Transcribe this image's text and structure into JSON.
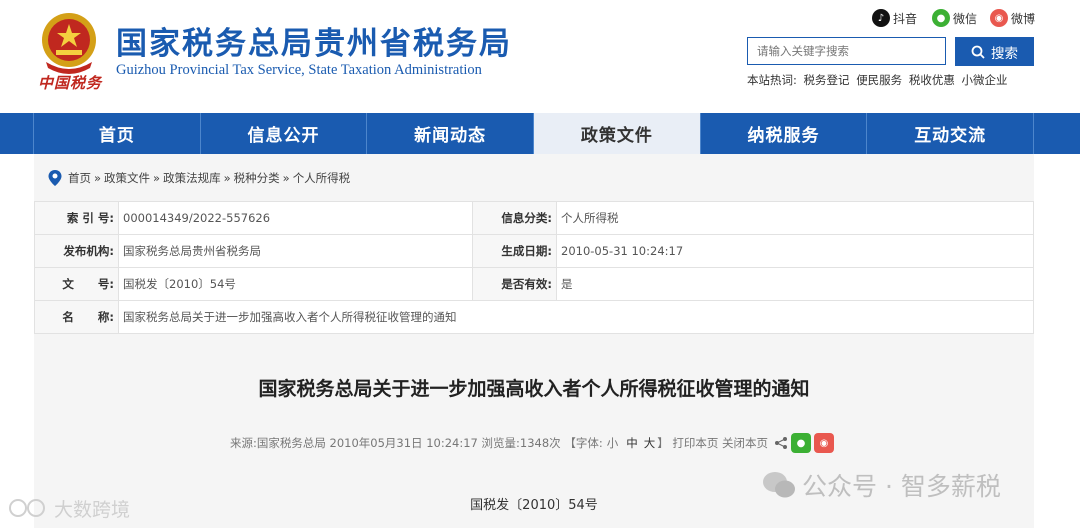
{
  "header": {
    "title": "国家税务总局贵州省税务局",
    "subtitle": "Guizhou Provincial Tax Service, State Taxation Administration",
    "logo_text": "中国税务",
    "social": [
      {
        "label": "抖音",
        "icon": "douyin-icon",
        "color": "#111111"
      },
      {
        "label": "微信",
        "icon": "wechat-icon",
        "color": "#3cb034"
      },
      {
        "label": "微博",
        "icon": "weibo-icon",
        "color": "#e9584f"
      }
    ],
    "search": {
      "placeholder": "请输入关键字搜索",
      "button_label": "搜索"
    },
    "hot_words_label": "本站热词:",
    "hot_words": [
      "税务登记",
      "便民服务",
      "税收优惠",
      "小微企业"
    ]
  },
  "nav": {
    "items": [
      "首页",
      "信息公开",
      "新闻动态",
      "政策文件",
      "纳税服务",
      "互动交流"
    ],
    "active_index": 3
  },
  "breadcrumb": {
    "items": [
      "首页",
      "政策文件",
      "政策法规库",
      "税种分类",
      "个人所得税"
    ],
    "separator": "»"
  },
  "meta": {
    "index_label": "索 引 号:",
    "index_value": "000014349/2022-557626",
    "category_label": "信息分类:",
    "category_value": "个人所得税",
    "issuer_label": "发布机构:",
    "issuer_value": "国家税务总局贵州省税务局",
    "date_label": "生成日期:",
    "date_value": "2010-05-31 10:24:17",
    "docno_label": "文      号:",
    "docno_value": "国税发〔2010〕54号",
    "valid_label": "是否有效:",
    "valid_value": "是",
    "name_label": "名      称:",
    "name_value": "国家税务总局关于进一步加强高收入者个人所得税征收管理的通知"
  },
  "document": {
    "title": "国家税务总局关于进一步加强高收入者个人所得税征收管理的通知",
    "info_source": "来源:国家税务总局 2010年05月31日 10:24:17 浏览量:1348次 【字体:",
    "font_small": "小",
    "font_medium": "中",
    "font_large": "大",
    "info_actions": "】 打印本页 关闭本页",
    "number": "国税发〔2010〕54号"
  },
  "watermarks": {
    "right": "公众号 · 智多薪税",
    "left": "大数跨境"
  },
  "colors": {
    "brand_blue": "#1a5bb0",
    "logo_red": "#c0281f"
  }
}
